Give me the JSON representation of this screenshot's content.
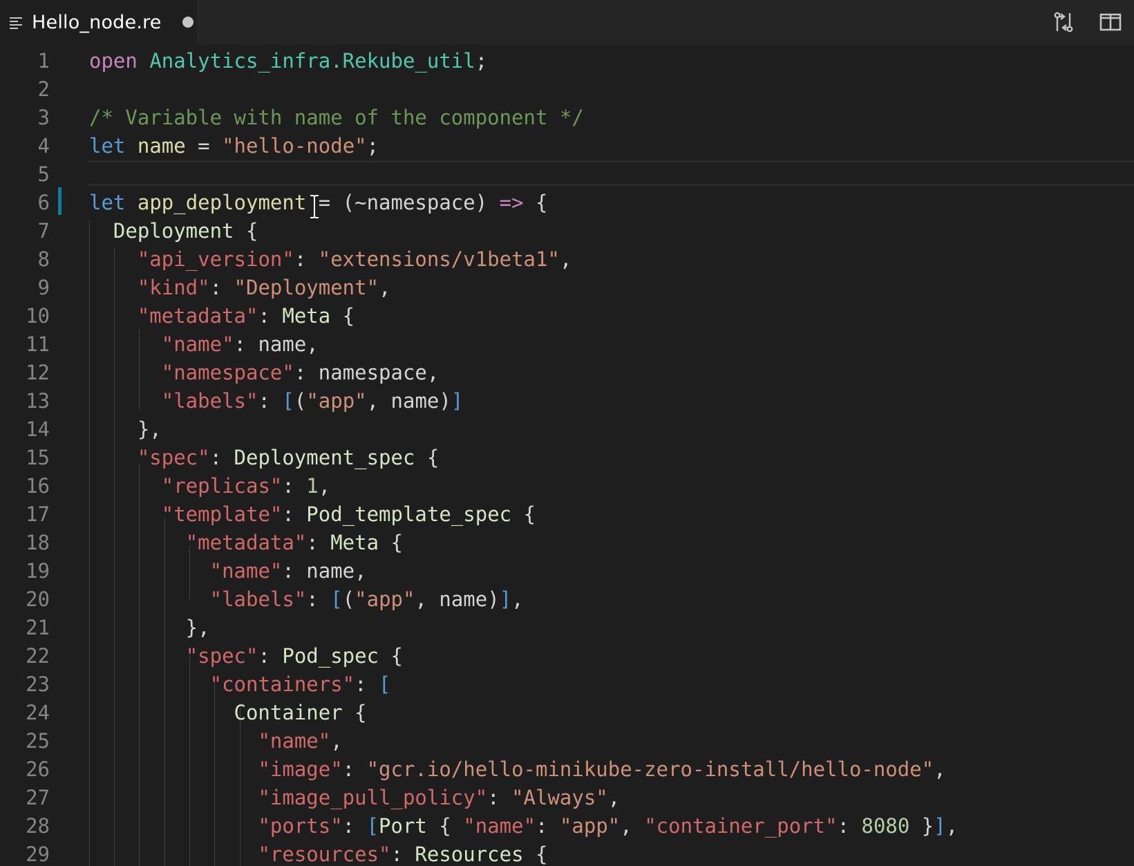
{
  "tab": {
    "title": "Hello_node.re",
    "icon": "lines-icon",
    "dirty": true
  },
  "actions": [
    {
      "name": "open-changes-icon"
    },
    {
      "name": "split-editor-icon"
    }
  ],
  "colors": {
    "editor_bg": "#1e1e1e",
    "tabbar_bg": "#252526",
    "line_number": "#858585",
    "modified_gutter": "#0c7d9d"
  },
  "editor": {
    "current_line": 5,
    "lines": [
      {
        "n": "1",
        "tokens": [
          [
            "kw",
            "open"
          ],
          [
            "op",
            " "
          ],
          [
            "mod",
            "Analytics_infra.Rekube_util"
          ],
          [
            "op",
            ";"
          ]
        ]
      },
      {
        "n": "2",
        "tokens": []
      },
      {
        "n": "3",
        "tokens": [
          [
            "com",
            "/* Variable with name of the component */"
          ]
        ]
      },
      {
        "n": "4",
        "tokens": [
          [
            "kb",
            "let"
          ],
          [
            "op",
            " "
          ],
          [
            "fn",
            "name"
          ],
          [
            "op",
            " = "
          ],
          [
            "str",
            "\"hello-node\""
          ],
          [
            "op",
            ";"
          ]
        ]
      },
      {
        "n": "5",
        "tokens": []
      },
      {
        "n": "6",
        "tokens": [
          [
            "kb",
            "let"
          ],
          [
            "op",
            " "
          ],
          [
            "fn",
            "app_deployment"
          ],
          [
            "op",
            " = (~namespace) "
          ],
          [
            "kw",
            "=>"
          ],
          [
            "op",
            " {"
          ]
        ]
      },
      {
        "n": "7",
        "tokens": [
          [
            "op",
            "  "
          ],
          [
            "ty",
            "Deployment"
          ],
          [
            "op",
            " {"
          ]
        ]
      },
      {
        "n": "8",
        "tokens": [
          [
            "op",
            "    "
          ],
          [
            "key",
            "\"api_version\""
          ],
          [
            "op",
            ": "
          ],
          [
            "str",
            "\"extensions/v1beta1\""
          ],
          [
            "op",
            ","
          ]
        ]
      },
      {
        "n": "9",
        "tokens": [
          [
            "op",
            "    "
          ],
          [
            "key",
            "\"kind\""
          ],
          [
            "op",
            ": "
          ],
          [
            "str",
            "\"Deployment\""
          ],
          [
            "op",
            ","
          ]
        ]
      },
      {
        "n": "10",
        "tokens": [
          [
            "op",
            "    "
          ],
          [
            "key",
            "\"metadata\""
          ],
          [
            "op",
            ": "
          ],
          [
            "ty",
            "Meta"
          ],
          [
            "op",
            " {"
          ]
        ]
      },
      {
        "n": "11",
        "tokens": [
          [
            "op",
            "      "
          ],
          [
            "key",
            "\"name\""
          ],
          [
            "op",
            ": name,"
          ]
        ]
      },
      {
        "n": "12",
        "tokens": [
          [
            "op",
            "      "
          ],
          [
            "key",
            "\"namespace\""
          ],
          [
            "op",
            ": namespace,"
          ]
        ]
      },
      {
        "n": "13",
        "tokens": [
          [
            "op",
            "      "
          ],
          [
            "key",
            "\"labels\""
          ],
          [
            "op",
            ": "
          ],
          [
            "br",
            "["
          ],
          [
            "op",
            "("
          ],
          [
            "str",
            "\"app\""
          ],
          [
            "op",
            ", name)"
          ],
          [
            "br",
            "]"
          ]
        ]
      },
      {
        "n": "14",
        "tokens": [
          [
            "op",
            "    },"
          ]
        ]
      },
      {
        "n": "15",
        "tokens": [
          [
            "op",
            "    "
          ],
          [
            "key",
            "\"spec\""
          ],
          [
            "op",
            ": "
          ],
          [
            "ty",
            "Deployment_spec"
          ],
          [
            "op",
            " {"
          ]
        ]
      },
      {
        "n": "16",
        "tokens": [
          [
            "op",
            "      "
          ],
          [
            "key",
            "\"replicas\""
          ],
          [
            "op",
            ": "
          ],
          [
            "num",
            "1"
          ],
          [
            "op",
            ","
          ]
        ]
      },
      {
        "n": "17",
        "tokens": [
          [
            "op",
            "      "
          ],
          [
            "key",
            "\"template\""
          ],
          [
            "op",
            ": "
          ],
          [
            "ty",
            "Pod_template_spec"
          ],
          [
            "op",
            " {"
          ]
        ]
      },
      {
        "n": "18",
        "tokens": [
          [
            "op",
            "        "
          ],
          [
            "key",
            "\"metadata\""
          ],
          [
            "op",
            ": "
          ],
          [
            "ty",
            "Meta"
          ],
          [
            "op",
            " {"
          ]
        ]
      },
      {
        "n": "19",
        "tokens": [
          [
            "op",
            "          "
          ],
          [
            "key",
            "\"name\""
          ],
          [
            "op",
            ": name,"
          ]
        ]
      },
      {
        "n": "20",
        "tokens": [
          [
            "op",
            "          "
          ],
          [
            "key",
            "\"labels\""
          ],
          [
            "op",
            ": "
          ],
          [
            "br",
            "["
          ],
          [
            "op",
            "("
          ],
          [
            "str",
            "\"app\""
          ],
          [
            "op",
            ", name)"
          ],
          [
            "br",
            "]"
          ],
          [
            "op",
            ","
          ]
        ]
      },
      {
        "n": "21",
        "tokens": [
          [
            "op",
            "        },"
          ]
        ]
      },
      {
        "n": "22",
        "tokens": [
          [
            "op",
            "        "
          ],
          [
            "key",
            "\"spec\""
          ],
          [
            "op",
            ": "
          ],
          [
            "ty",
            "Pod_spec"
          ],
          [
            "op",
            " {"
          ]
        ]
      },
      {
        "n": "23",
        "tokens": [
          [
            "op",
            "          "
          ],
          [
            "key",
            "\"containers\""
          ],
          [
            "op",
            ": "
          ],
          [
            "br",
            "["
          ]
        ]
      },
      {
        "n": "24",
        "tokens": [
          [
            "op",
            "            "
          ],
          [
            "ty",
            "Container"
          ],
          [
            "op",
            " {"
          ]
        ]
      },
      {
        "n": "25",
        "tokens": [
          [
            "op",
            "              "
          ],
          [
            "key",
            "\"name\""
          ],
          [
            "op",
            ","
          ]
        ]
      },
      {
        "n": "26",
        "tokens": [
          [
            "op",
            "              "
          ],
          [
            "key",
            "\"image\""
          ],
          [
            "op",
            ": "
          ],
          [
            "str",
            "\"gcr.io/hello-minikube-zero-install/hello-node\""
          ],
          [
            "op",
            ","
          ]
        ]
      },
      {
        "n": "27",
        "tokens": [
          [
            "op",
            "              "
          ],
          [
            "key",
            "\"image_pull_policy\""
          ],
          [
            "op",
            ": "
          ],
          [
            "str",
            "\"Always\""
          ],
          [
            "op",
            ","
          ]
        ]
      },
      {
        "n": "28",
        "tokens": [
          [
            "op",
            "              "
          ],
          [
            "key",
            "\"ports\""
          ],
          [
            "op",
            ": "
          ],
          [
            "br",
            "["
          ],
          [
            "ty",
            "Port"
          ],
          [
            "op",
            " { "
          ],
          [
            "key",
            "\"name\""
          ],
          [
            "op",
            ": "
          ],
          [
            "str",
            "\"app\""
          ],
          [
            "op",
            ", "
          ],
          [
            "key",
            "\"container_port\""
          ],
          [
            "op",
            ": "
          ],
          [
            "num",
            "8080"
          ],
          [
            "op",
            " }"
          ],
          [
            "br",
            "]"
          ],
          [
            "op",
            ","
          ]
        ]
      },
      {
        "n": "29",
        "tokens": [
          [
            "op",
            "              "
          ],
          [
            "key",
            "\"resources\""
          ],
          [
            "op",
            ": "
          ],
          [
            "ty",
            "Resources"
          ],
          [
            "op",
            " {"
          ]
        ]
      }
    ]
  }
}
